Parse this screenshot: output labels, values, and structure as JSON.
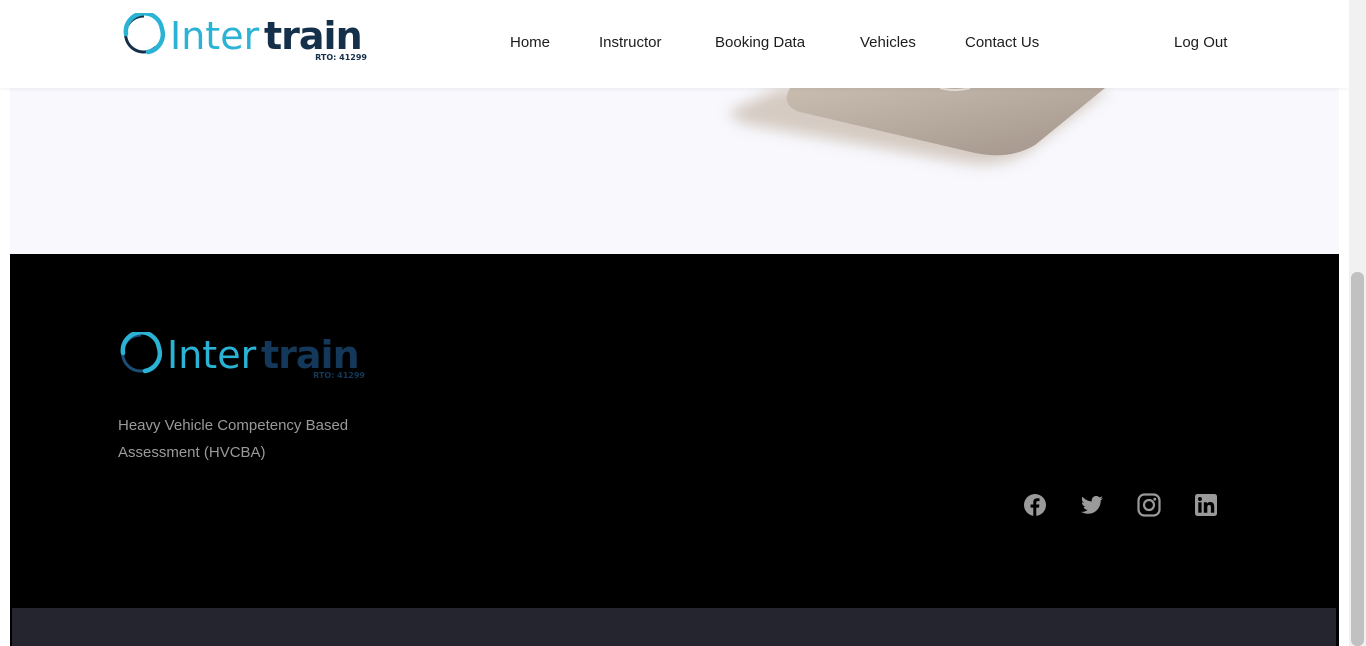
{
  "header": {
    "logo": {
      "wordmark_light": "Inter",
      "wordmark_bold": "train",
      "rto": "RTO: 41299"
    },
    "nav": [
      {
        "label": "Home"
      },
      {
        "label": "Instructor"
      },
      {
        "label": "Booking Data"
      },
      {
        "label": "Vehicles"
      },
      {
        "label": "Contact Us"
      }
    ],
    "logout_label": "Log Out"
  },
  "footer": {
    "logo": {
      "wordmark_light": "Inter",
      "wordmark_bold": "train",
      "rto": "RTO: 41299"
    },
    "tagline": "Heavy Vehicle Competency Based Assessment (HVCBA)",
    "social": [
      {
        "icon": "facebook-icon"
      },
      {
        "icon": "twitter-icon"
      },
      {
        "icon": "instagram-icon"
      },
      {
        "icon": "linkedin-icon"
      }
    ]
  },
  "colors": {
    "brand_cyan": "#2bb3d6",
    "brand_navy": "#14304a",
    "footer_bg": "#000000",
    "bottom_bar": "#25252f",
    "section_bg": "#f8f8fd"
  }
}
